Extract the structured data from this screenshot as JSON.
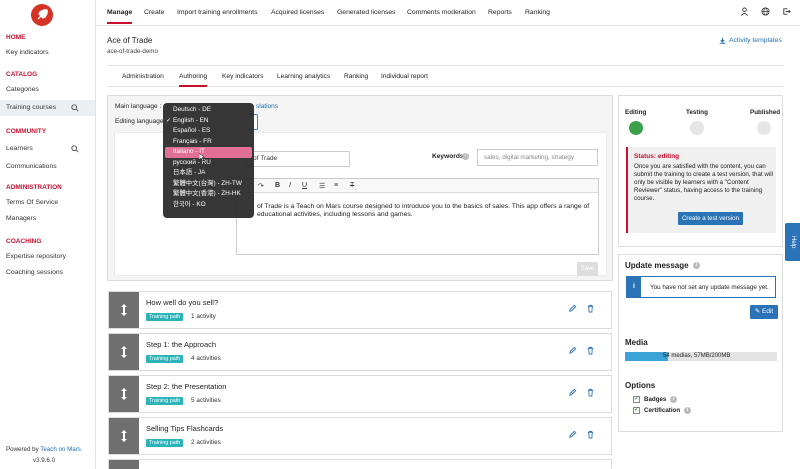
{
  "sidebar": {
    "sections": [
      {
        "heading": "HOME",
        "items": [
          "Key indicators"
        ]
      },
      {
        "heading": "CATALOG",
        "items": [
          "Categories",
          "Training courses"
        ]
      },
      {
        "heading": "COMMUNITY",
        "items": [
          "Learners",
          "Communications"
        ]
      },
      {
        "heading": "ADMINISTRATION",
        "items": [
          "Terms Of Service",
          "Managers"
        ]
      },
      {
        "heading": "COACHING",
        "items": [
          "Expertise repository",
          "Coaching sessions"
        ]
      }
    ],
    "powered_prefix": "Powered by",
    "powered_link": "Teach on Mars",
    "version": "v3.9.6.0"
  },
  "topnav": [
    "Manage",
    "Create",
    "Import training enrollments",
    "Acquired licenses",
    "Generated licenses",
    "Comments moderation",
    "Reports",
    "Ranking"
  ],
  "header": {
    "title": "Ace of Trade",
    "slug": "ace-of-trade-demo",
    "activity_templates": "Activity templates"
  },
  "tabs": [
    "Administration",
    "Authoring",
    "Key indicators",
    "Learning analytics",
    "Ranking",
    "Individual report"
  ],
  "form": {
    "main_language_label": "Main language :",
    "translations_link": "slations",
    "editing_language_label": "Editing language",
    "title_value": "of Trade",
    "keywords_label": "Keywords",
    "keywords_placeholder": "sales, digital marketing, strategy",
    "description": "of Trade is a Teach on Mars course designed to introduce you to the basics of sales. This app offers a range of educational activities, including lessons and games.",
    "save_label": "Save"
  },
  "languages": [
    {
      "label": "Deutsch - DE",
      "checked": false,
      "hover": false
    },
    {
      "label": "English - EN",
      "checked": true,
      "hover": false
    },
    {
      "label": "Español - ES",
      "checked": false,
      "hover": false
    },
    {
      "label": "Français - FR",
      "checked": false,
      "hover": false
    },
    {
      "label": "Italiano - IT",
      "checked": false,
      "hover": true
    },
    {
      "label": "русский - RU",
      "checked": false,
      "hover": false
    },
    {
      "label": "日本語 - JA",
      "checked": false,
      "hover": false
    },
    {
      "label": "繁體中文(台灣) - ZH-TW",
      "checked": false,
      "hover": false
    },
    {
      "label": "繁體中文(香港) - ZH-HK",
      "checked": false,
      "hover": false
    },
    {
      "label": "한국어 - KO",
      "checked": false,
      "hover": false
    }
  ],
  "activities": [
    {
      "title": "How well do you sell?",
      "badge": "Training path",
      "count": "1 activity"
    },
    {
      "title": "Step 1: the Approach",
      "badge": "Training path",
      "count": "4 activities"
    },
    {
      "title": "Step 2: the Presentation",
      "badge": "Training path",
      "count": "5 activities"
    },
    {
      "title": "Selling Tips Flashcards",
      "badge": "Training path",
      "count": "2 activities"
    }
  ],
  "status": {
    "stages": [
      "Editing",
      "Testing",
      "Published"
    ],
    "current_stage": 0,
    "title": "Status: editing",
    "text": "Once you are satisfied with the content, you can submit the training to create a test version, that will only be visible by learners with a \"Content Reviewer\" status, having access to the training course.",
    "button": "Create a test version"
  },
  "update": {
    "title": "Update message",
    "info_text": "You have not set any update message yet.",
    "edit_label": "Edit"
  },
  "media": {
    "title": "Media",
    "usage_text": "54 medias, 57MB/200MB",
    "used_fraction": 0.285
  },
  "options": {
    "title": "Options",
    "items": [
      "Badges",
      "Certification"
    ]
  },
  "help_label": "Help",
  "colors": {
    "brand_red": "#c8102e",
    "primary_blue": "#2b73b7",
    "teal_badge": "#2bb3b9",
    "editing_green": "#3aa04a",
    "hover_pink": "#e26f96"
  }
}
